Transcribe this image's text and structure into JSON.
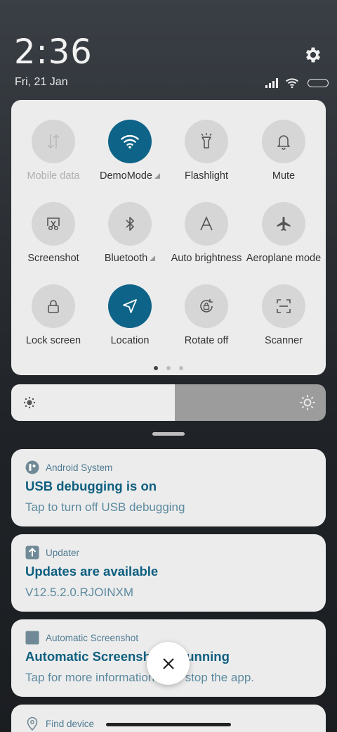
{
  "status": {
    "time": "2:36",
    "date": "Fri, 21 Jan"
  },
  "quick_settings": {
    "tiles": [
      {
        "label": "Mobile data",
        "icon": "mobile-data-icon",
        "active": false,
        "disabled": true
      },
      {
        "label": "DemoMode",
        "icon": "wifi-icon",
        "active": true,
        "expandable": true
      },
      {
        "label": "Flashlight",
        "icon": "flashlight-icon",
        "active": false
      },
      {
        "label": "Mute",
        "icon": "bell-icon",
        "active": false
      },
      {
        "label": "Screenshot",
        "icon": "screenshot-icon",
        "active": false
      },
      {
        "label": "Bluetooth",
        "icon": "bluetooth-icon",
        "active": false,
        "expandable": true
      },
      {
        "label": "Auto brightness",
        "icon": "auto-brightness-icon",
        "active": false
      },
      {
        "label": "Aeroplane mode",
        "icon": "airplane-icon",
        "active": false
      },
      {
        "label": "Lock screen",
        "icon": "lock-icon",
        "active": false
      },
      {
        "label": "Location",
        "icon": "location-icon",
        "active": true
      },
      {
        "label": "Rotate off",
        "icon": "rotate-lock-icon",
        "active": false
      },
      {
        "label": "Scanner",
        "icon": "scanner-icon",
        "active": false
      }
    ],
    "pages": 3,
    "current_page": 1
  },
  "brightness": {
    "level": 0.52
  },
  "notifications": [
    {
      "app": "Android System",
      "title": "USB debugging is on",
      "body": "Tap to turn off USB debugging",
      "icon": "android-system-icon"
    },
    {
      "app": "Updater",
      "title": "Updates are available",
      "body": "V12.5.2.0.RJOINXM",
      "icon": "updater-icon"
    },
    {
      "app": "Automatic Screenshot",
      "title": "Automatic Screenshot is running",
      "body": "Tap for more information or to stop the app.",
      "icon": "app-square-icon"
    },
    {
      "app": "Find device",
      "title": "",
      "body": "",
      "icon": "location-pin-icon"
    }
  ],
  "colors": {
    "accent": "#0e6488",
    "panel": "#ececec",
    "title_text": "#0e5f80"
  }
}
